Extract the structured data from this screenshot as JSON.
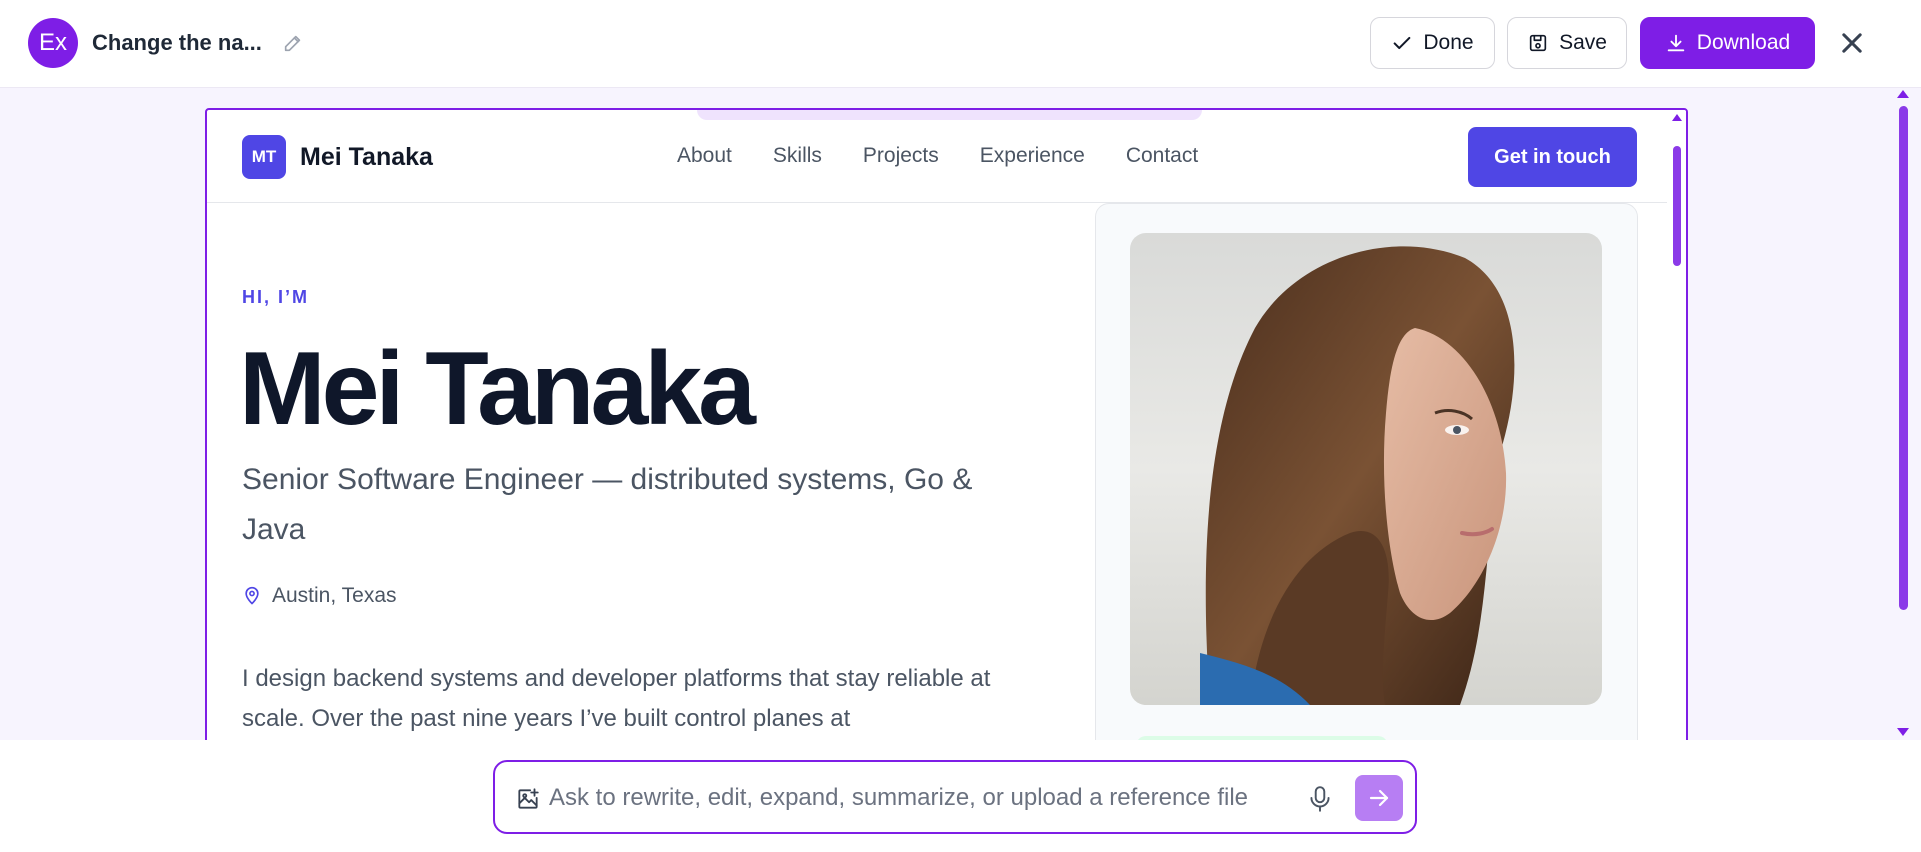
{
  "topbar": {
    "badge": "Ex",
    "title": "Change the na...",
    "done_label": "Done",
    "save_label": "Save",
    "download_label": "Download"
  },
  "site": {
    "logo": "MT",
    "brand": "Mei Tanaka",
    "nav": [
      "About",
      "Skills",
      "Projects",
      "Experience",
      "Contact"
    ],
    "cta": "Get in touch"
  },
  "hero": {
    "eyebrow": "HI, I’M",
    "name": "Mei Tanaka",
    "subtitle": "Senior Software Engineer — distributed systems, Go & Java",
    "location": "Austin, Texas",
    "bio": "I design backend systems and developer platforms that stay reliable at scale. Over the past nine years I’ve built control planes at"
  },
  "prompt": {
    "placeholder": "Ask to rewrite, edit, expand, summarize, or upload a reference file"
  },
  "colors": {
    "accent": "#7e1ee6",
    "site_primary": "#4f46e5",
    "heading": "#0f172a",
    "body_text": "#4b5563"
  },
  "icons": [
    "pencil-icon",
    "check-icon",
    "save-icon",
    "download-icon",
    "close-icon",
    "location-pin-icon",
    "image-upload-icon",
    "microphone-icon",
    "arrow-right-icon"
  ]
}
